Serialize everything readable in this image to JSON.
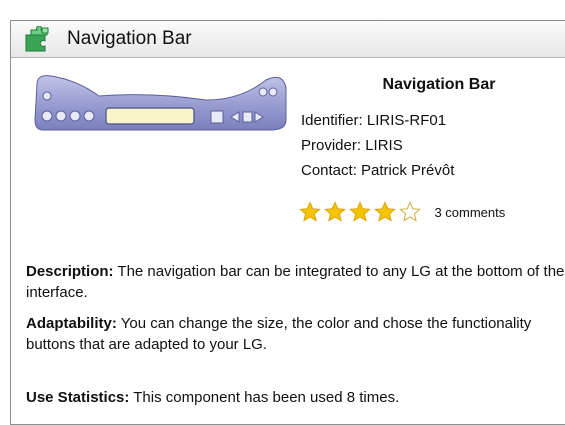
{
  "window": {
    "title": "Navigation Bar",
    "icon": "puzzle-piece-icon"
  },
  "component": {
    "name": "Navigation Bar",
    "identifier": "Identifier: LIRIS-RF01",
    "provider": "Provider: LIRIS",
    "contact": "Contact: Patrick Prévôt",
    "rating": {
      "stars_filled": 4,
      "stars_total": 5,
      "comments": "3 comments"
    }
  },
  "details": {
    "description_label": "Description:",
    "description_text": " The navigation bar can be integrated to any LG at the bottom of the interface.",
    "adaptability_label": "Adaptability:",
    "adaptability_text": " You can change the size, the color and chose the functionality buttons that are adapted to your LG.",
    "stats_label": "Use Statistics:",
    "stats_text": " This component has been used 8 times."
  },
  "colors": {
    "star_fill": "#f5c400",
    "nav_bar_body": "#8f93c9",
    "puzzle_green": "#3aa655"
  }
}
